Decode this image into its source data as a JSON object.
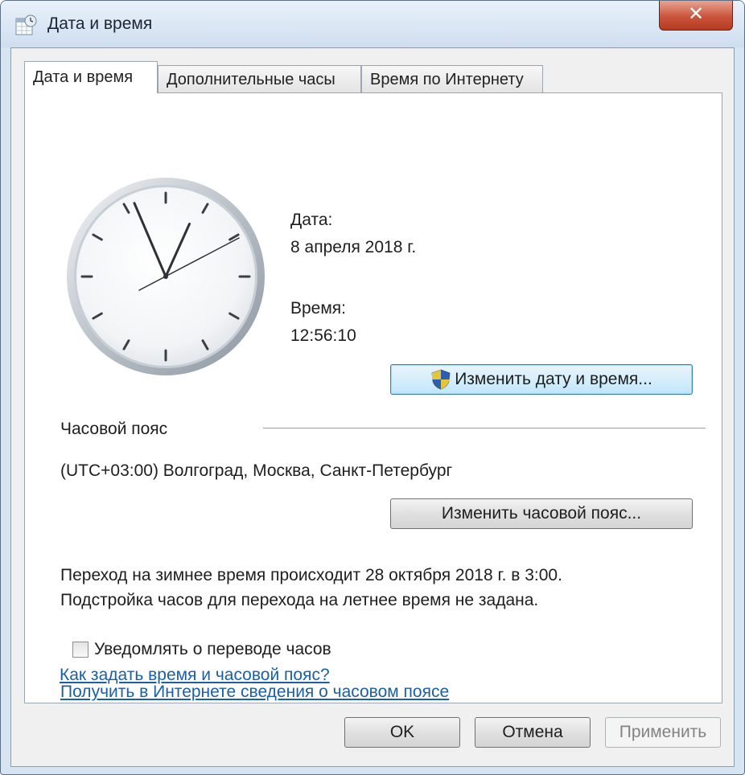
{
  "window": {
    "title": "Дата и время",
    "close_label": "✕",
    "close_icon": "close-icon"
  },
  "tabs": [
    {
      "label": "Дата и время",
      "active": true
    },
    {
      "label": "Дополнительные часы",
      "active": false
    },
    {
      "label": "Время по Интернету",
      "active": false
    }
  ],
  "datetime": {
    "date_label": "Дата:",
    "date_value": "8 апреля 2018 г.",
    "time_label": "Время:",
    "time_value": "12:56:10",
    "change_button": "Изменить дату и время..."
  },
  "timezone": {
    "section_label": "Часовой пояс",
    "value": "(UTC+03:00) Волгоград, Москва, Санкт-Петербург",
    "change_button": "Изменить часовой пояс..."
  },
  "dst": {
    "line1": "Переход на зимнее время происходит 28 октября 2018 г. в 3:00.",
    "line2": "Подстройка часов для перехода на летнее время не задана."
  },
  "notify": {
    "label": "Уведомлять о переводе часов",
    "checked": false
  },
  "links": {
    "timezone_info": "Получить в Интернете сведения о часовом поясе",
    "how_to": "Как задать время и часовой пояс?"
  },
  "footer": {
    "ok": "OK",
    "cancel": "Отмена",
    "apply": "Применить"
  },
  "colors": {
    "link": "#1b5fa6",
    "close_button": "#c9553c",
    "accent_border": "#3c7fb1"
  }
}
